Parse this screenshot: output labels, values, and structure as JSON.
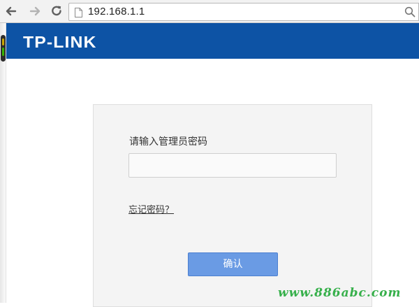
{
  "browser": {
    "address": "192.168.1.1",
    "back_icon": "back-arrow-icon",
    "forward_icon": "forward-arrow-icon",
    "reload_icon": "reload-icon",
    "page_icon": "page-icon",
    "search_icon": "search-icon"
  },
  "header": {
    "brand": "TP-LINK",
    "color": "#0d53a5"
  },
  "login": {
    "prompt": "请输入管理员密码",
    "password_value": "",
    "forgot_link": "忘记密码？",
    "confirm_label": "确认",
    "confirm_color": "#6a9be4"
  },
  "watermark": {
    "text": "www.886abc.com",
    "color": "#37b04b"
  }
}
